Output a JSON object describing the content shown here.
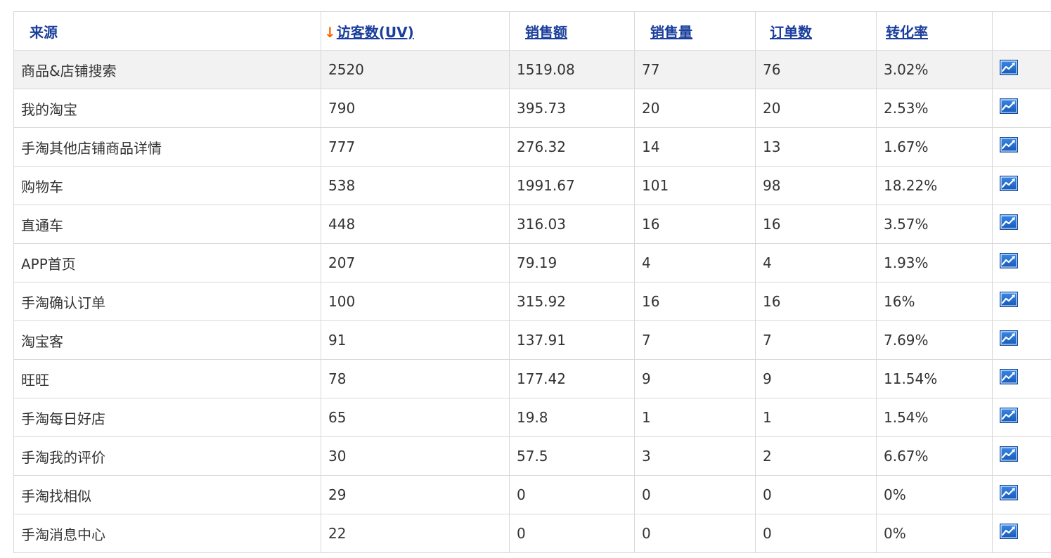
{
  "table": {
    "headers": {
      "source": "来源",
      "uv_arrow": "↓",
      "uv": "访客数(UV)",
      "sales_amount": "销售额",
      "sales_qty": "销售量",
      "orders": "订单数",
      "conversion": "转化率"
    },
    "rows": [
      {
        "source": "商品&店铺搜索",
        "uv": "2520",
        "sales_amount": "1519.08",
        "sales_qty": "77",
        "orders": "76",
        "conversion": "3.02%"
      },
      {
        "source": "我的淘宝",
        "uv": "790",
        "sales_amount": "395.73",
        "sales_qty": "20",
        "orders": "20",
        "conversion": "2.53%"
      },
      {
        "source": "手淘其他店铺商品详情",
        "uv": "777",
        "sales_amount": "276.32",
        "sales_qty": "14",
        "orders": "13",
        "conversion": "1.67%"
      },
      {
        "source": "购物车",
        "uv": "538",
        "sales_amount": "1991.67",
        "sales_qty": "101",
        "orders": "98",
        "conversion": "18.22%"
      },
      {
        "source": "直通车",
        "uv": "448",
        "sales_amount": "316.03",
        "sales_qty": "16",
        "orders": "16",
        "conversion": "3.57%"
      },
      {
        "source": "APP首页",
        "uv": "207",
        "sales_amount": "79.19",
        "sales_qty": "4",
        "orders": "4",
        "conversion": "1.93%"
      },
      {
        "source": "手淘确认订单",
        "uv": "100",
        "sales_amount": "315.92",
        "sales_qty": "16",
        "orders": "16",
        "conversion": "16%"
      },
      {
        "source": "淘宝客",
        "uv": "91",
        "sales_amount": "137.91",
        "sales_qty": "7",
        "orders": "7",
        "conversion": "7.69%"
      },
      {
        "source": "旺旺",
        "uv": "78",
        "sales_amount": "177.42",
        "sales_qty": "9",
        "orders": "9",
        "conversion": "11.54%"
      },
      {
        "source": "手淘每日好店",
        "uv": "65",
        "sales_amount": "19.8",
        "sales_qty": "1",
        "orders": "1",
        "conversion": "1.54%"
      },
      {
        "source": "手淘我的评价",
        "uv": "30",
        "sales_amount": "57.5",
        "sales_qty": "3",
        "orders": "2",
        "conversion": "6.67%"
      },
      {
        "source": "手淘找相似",
        "uv": "29",
        "sales_amount": "0",
        "sales_qty": "0",
        "orders": "0",
        "conversion": "0%"
      },
      {
        "source": "手淘消息中心",
        "uv": "22",
        "sales_amount": "0",
        "sales_qty": "0",
        "orders": "0",
        "conversion": "0%"
      }
    ]
  },
  "icons": {
    "trend": "trend-chart-icon"
  },
  "colors": {
    "header_text": "#1a3e9c",
    "sort_arrow": "#ff6600",
    "highlight_row": "#f2f2f2",
    "border": "#d9d9d9",
    "icon_blue": "#1f6fd1"
  }
}
